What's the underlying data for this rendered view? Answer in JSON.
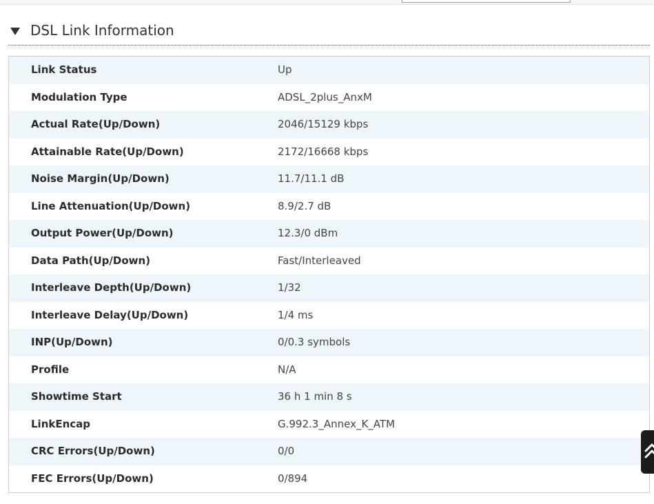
{
  "section": {
    "title": "DSL Link Information",
    "collapse_icon": "triangle-down-icon"
  },
  "rows": [
    {
      "label": "Link Status",
      "value": "Up"
    },
    {
      "label": "Modulation Type",
      "value": "ADSL_2plus_AnxM"
    },
    {
      "label": "Actual Rate(Up/Down)",
      "value": "2046/15129 kbps"
    },
    {
      "label": "Attainable Rate(Up/Down)",
      "value": "2172/16668 kbps"
    },
    {
      "label": "Noise Margin(Up/Down)",
      "value": "11.7/11.1 dB"
    },
    {
      "label": "Line Attenuation(Up/Down)",
      "value": "8.9/2.7 dB"
    },
    {
      "label": "Output Power(Up/Down)",
      "value": "12.3/0 dBm"
    },
    {
      "label": "Data Path(Up/Down)",
      "value": "Fast/Interleaved"
    },
    {
      "label": "Interleave Depth(Up/Down)",
      "value": "1/32"
    },
    {
      "label": "Interleave Delay(Up/Down)",
      "value": "1/4 ms"
    },
    {
      "label": "INP(Up/Down)",
      "value": "0/0.3 symbols"
    },
    {
      "label": "Profile",
      "value": "N/A"
    },
    {
      "label": "Showtime Start",
      "value": "36 h 1 min 8 s"
    },
    {
      "label": "LinkEncap",
      "value": "G.992.3_Annex_K_ATM"
    },
    {
      "label": "CRC Errors(Up/Down)",
      "value": "0/0"
    },
    {
      "label": "FEC Errors(Up/Down)",
      "value": "0/894"
    }
  ],
  "scroll_button": {
    "icon": "double-chevron-up-icon"
  },
  "colors": {
    "row_stripe": "#eef6fc",
    "label_text": "#2b2b2b",
    "value_text": "#444444",
    "scroll_button_bg": "#1c1c1c"
  }
}
